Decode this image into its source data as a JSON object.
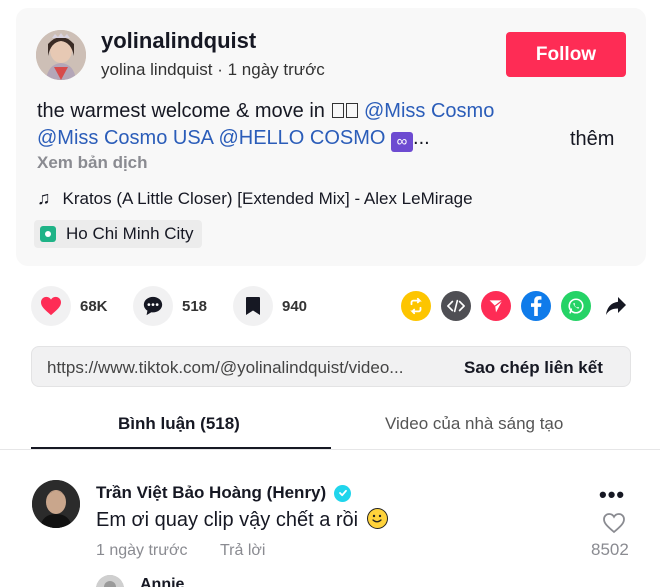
{
  "post": {
    "username": "yolinalindquist",
    "display_name": "yolina lindquist",
    "separator": " · ",
    "time": "1 ngày trước",
    "follow_label": "Follow",
    "desc_text": "the warmest welcome & move in ",
    "mentions": [
      "@Miss Cosmo",
      "@Miss Cosmo USA",
      "@HELLO COSMO"
    ],
    "ellipsis": "...",
    "more_label": "thêm",
    "translate_label": "Xem bản dịch",
    "music": "Kratos (A Little Closer) [Extended Mix] - Alex LeMirage",
    "location": "Ho Chi Minh City"
  },
  "actions": {
    "likes": "68K",
    "comments": "518",
    "saves": "940"
  },
  "share_icons": [
    "repost-icon",
    "embed-icon",
    "send-icon",
    "facebook-icon",
    "whatsapp-icon",
    "share-arrow-icon"
  ],
  "link": {
    "url": "https://www.tiktok.com/@yolinalindquist/video...",
    "copy_label": "Sao chép liên kết"
  },
  "tabs": {
    "comments_label": "Bình luận (518)",
    "creator_videos_label": "Video của nhà sáng tạo"
  },
  "comment": {
    "author": "Trần Việt Bảo Hoàng (Henry)",
    "text": "Em ơi quay clip vậy chết a rồi",
    "date": "1 ngày trước",
    "reply_label": "Trả lời",
    "likes": "8502"
  },
  "reply_preview": {
    "author": "Annie"
  },
  "colors": {
    "follow_bg": "#fe2c55",
    "mention": "#2b5db9",
    "repost": "#fdc500",
    "embed": "#4f4f54",
    "send": "#fe2c55",
    "facebook": "#0f7bea",
    "whatsapp": "#25d366"
  }
}
